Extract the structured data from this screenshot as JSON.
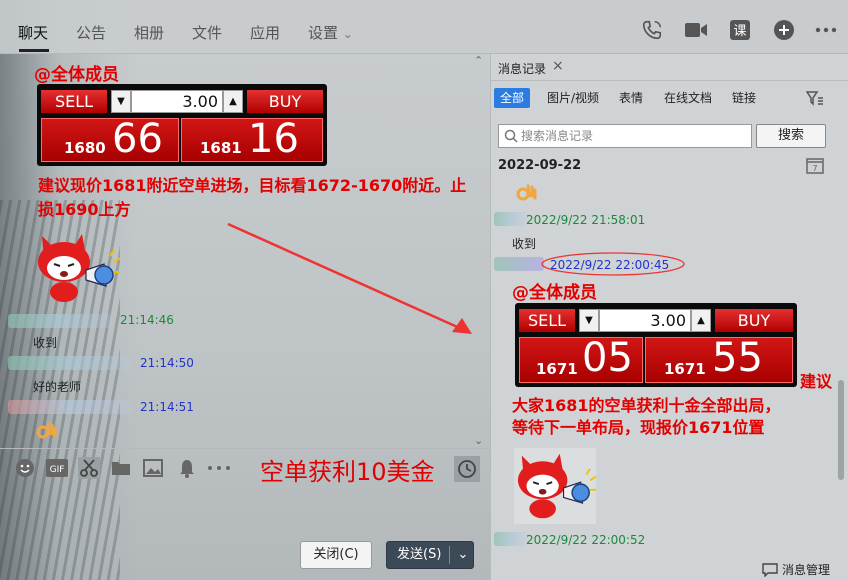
{
  "nav": {
    "tabs": [
      "聊天",
      "公告",
      "相册",
      "文件",
      "应用",
      "设置"
    ],
    "settings_chevron": "⌄"
  },
  "chat": {
    "mention": "@全体成员",
    "trade1": {
      "sell": "SELL",
      "buy": "BUY",
      "qty": "3.00",
      "sell_small": "1680",
      "sell_big": "66",
      "buy_small": "1681",
      "buy_big": "16"
    },
    "message1": "建议现价1681附近空单进场，目标看1672-1670附近。止损1690上方",
    "time1": "21:14:46",
    "reply1": "收到",
    "time2": "21:14:50",
    "reply2": "好的老师",
    "time3": "21:14:51",
    "overlay_text": "空单获利10美金",
    "close_button": "关闭(C)",
    "send_button": "发送(S)"
  },
  "history": {
    "tab_label": "消息记录",
    "filters": [
      "全部",
      "图片/视频",
      "表情",
      "在线文档",
      "链接"
    ],
    "search_placeholder": "搜索消息记录",
    "search_button": "搜索",
    "date_header": "2022-09-22",
    "calendar_day": "7",
    "time1": "2022/9/22 21:58:01",
    "reply1": "收到",
    "time2": "2022/9/22 22:00:45",
    "mention": "@全体成员",
    "trade2": {
      "sell": "SELL",
      "buy": "BUY",
      "qty": "3.00",
      "sell_small": "1671",
      "sell_big": "05",
      "buy_small": "1671",
      "buy_big": "55"
    },
    "advice_a": "建议",
    "advice_b": "大家1681的空单获利十金全部出局，",
    "advice_c": "等待下一单布局，现报价1671位置",
    "time3": "2022/9/22 22:00:52",
    "manager": "消息管理"
  },
  "colors": {
    "accent_red": "#e20000",
    "select_blue": "#2b7be0",
    "time_green": "#1a8a3a",
    "time_blue": "#2233cc"
  }
}
